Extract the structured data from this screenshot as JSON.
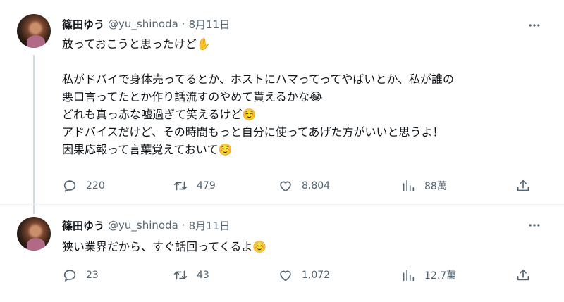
{
  "tweets": [
    {
      "name": "篠田ゆう",
      "handle": "@yu_shinoda",
      "separator": "·",
      "date": "8月11日",
      "lines": [
        "放っておこうと思ったけど✋",
        "",
        "私がドバイで身体売ってるとか、ホストにハマってってやばいとか、私が誰の",
        "悪口言ってたとか作り話流すのやめて貰えるかな😂",
        "どれも真っ赤な嘘過ぎて笑えるけど☺️",
        "アドバイスだけど、その時間もっと自分に使ってあげた方がいいと思うよ！",
        "因果応報って言葉覚えておいて☺️"
      ],
      "replies": "220",
      "retweets": "479",
      "likes": "8,804",
      "views": "88萬"
    },
    {
      "name": "篠田ゆう",
      "handle": "@yu_shinoda",
      "separator": "·",
      "date": "8月11日",
      "lines": [
        "狭い業界だから、すぐ話回ってくるよ☺️"
      ],
      "replies": "23",
      "retweets": "43",
      "likes": "1,072",
      "views": "12.7萬"
    }
  ],
  "icons": {
    "reply": "reply-icon",
    "retweet": "retweet-icon",
    "like": "like-icon",
    "views": "views-icon",
    "share": "share-icon",
    "more": "more-icon"
  },
  "colors": {
    "text": "#0f1419",
    "secondary": "#536471",
    "thread_line": "#cfd9de",
    "divider": "#eff3f4"
  }
}
